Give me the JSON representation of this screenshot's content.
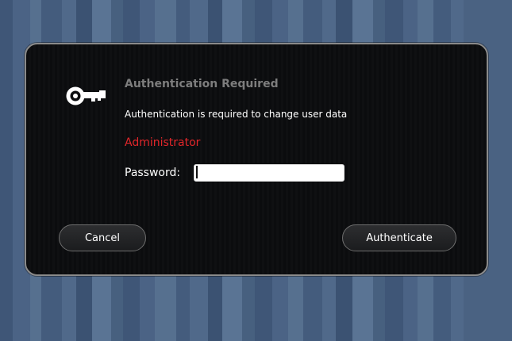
{
  "dialog": {
    "icon": "key-icon",
    "title": "Authentication Required",
    "message": "Authentication is required to change user data",
    "user": "Administrator",
    "password_label": "Password:",
    "password_value": "",
    "cancel_label": "Cancel",
    "authenticate_label": "Authenticate"
  },
  "colors": {
    "background": "#4a6282",
    "dialog_background": "#0d0e10",
    "title": "#7d7d7d",
    "user": "#e2262a",
    "text": "#ffffff"
  }
}
